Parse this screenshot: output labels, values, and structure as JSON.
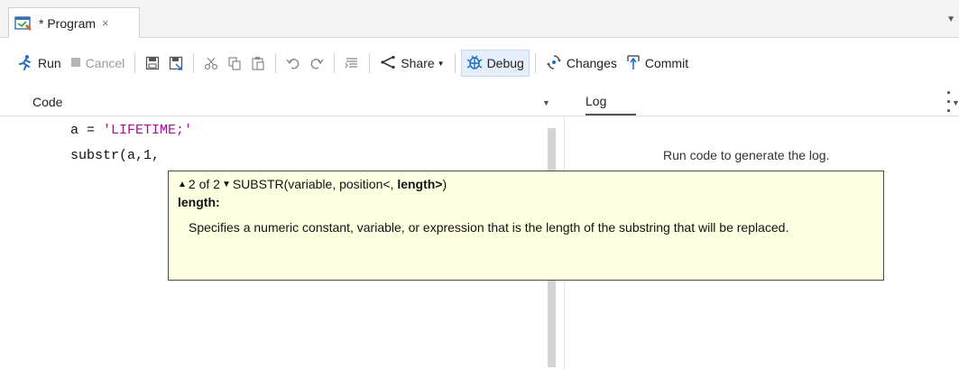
{
  "tab": {
    "title": "* Program",
    "close": "×",
    "icon": "program-icon"
  },
  "toolbar": {
    "run": "Run",
    "cancel": "Cancel",
    "share": "Share",
    "debug": "Debug",
    "changes": "Changes",
    "commit": "Commit"
  },
  "code_pane": {
    "header": "Code",
    "lines": [
      {
        "prefix": "a = ",
        "string": "'LIFETIME;'"
      },
      {
        "text": "substr(a,1,"
      }
    ]
  },
  "log_pane": {
    "header": "Log",
    "message": "Run code to generate the log."
  },
  "tooltip": {
    "counter": "2 of 2",
    "signature_prefix": "SUBSTR(variable, position<, ",
    "signature_bold": "length>",
    "signature_suffix": ")",
    "param_name": "length:",
    "description": "Specifies a numeric constant, variable, or expression that is the length of the substring that will be replaced."
  },
  "colors": {
    "string_literal": "#a0128e",
    "run_icon": "#1f6fc9",
    "tooltip_bg": "#ffffe1"
  }
}
